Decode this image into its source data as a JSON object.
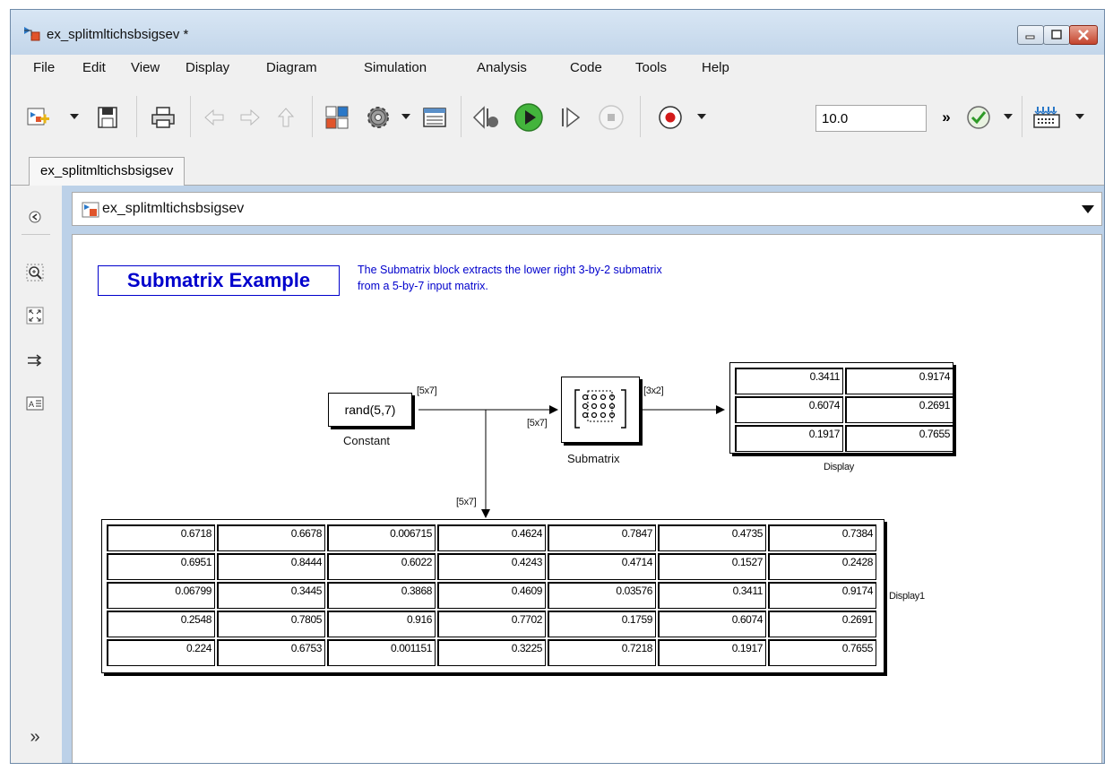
{
  "window": {
    "title": "ex_splitmltichsbsigsev *",
    "minimize_icon": "minimize-icon",
    "maximize_icon": "maximize-icon",
    "close_icon": "close-icon"
  },
  "menu": [
    "File",
    "Edit",
    "View",
    "Display",
    "Diagram",
    "Simulation",
    "Analysis",
    "Code",
    "Tools",
    "Help"
  ],
  "toolbar": {
    "stop_time": "10.0",
    "more_glyph": "»",
    "icons": [
      "new-model-icon",
      "save-icon",
      "print-icon",
      "back-icon",
      "forward-icon",
      "up-icon",
      "library-browser-icon",
      "settings-gear-icon",
      "model-explorer-icon",
      "step-back-icon",
      "run-icon",
      "step-forward-icon",
      "stop-icon",
      "record-icon",
      "more-icon",
      "check-icon",
      "build-icon"
    ]
  },
  "tab": {
    "label": "ex_splitmltichsbsigsev"
  },
  "address": {
    "path": "ex_splitmltichsbsigsev"
  },
  "leftbar": {
    "collapse_glyph": "»"
  },
  "diagram": {
    "title": "Submatrix Example",
    "description": [
      "The Submatrix block extracts the lower right 3-by-2 submatrix",
      "from a 5-by-7 input matrix."
    ],
    "constant": {
      "text": "rand(5,7)",
      "label": "Constant"
    },
    "submatrix": {
      "label": "Submatrix"
    },
    "display": {
      "label": "Display",
      "values": [
        [
          "0.3411",
          "0.9174"
        ],
        [
          "0.6074",
          "0.2691"
        ],
        [
          "0.1917",
          "0.7655"
        ]
      ]
    },
    "display1": {
      "label": "Display1",
      "values": [
        [
          "0.6718",
          "0.6678",
          "0.006715",
          "0.4624",
          "0.7847",
          "0.4735",
          "0.7384"
        ],
        [
          "0.6951",
          "0.8444",
          "0.6022",
          "0.4243",
          "0.4714",
          "0.1527",
          "0.2428"
        ],
        [
          "0.06799",
          "0.3445",
          "0.3868",
          "0.4609",
          "0.03576",
          "0.3411",
          "0.9174"
        ],
        [
          "0.2548",
          "0.7805",
          "0.916",
          "0.7702",
          "0.1759",
          "0.6074",
          "0.2691"
        ],
        [
          "0.224",
          "0.6753",
          "0.001151",
          "0.3225",
          "0.7218",
          "0.1917",
          "0.7655"
        ]
      ]
    },
    "signals": {
      "constant_out": "[5x7]",
      "submatrix_in": "[5x7]",
      "submatrix_out": "[3x2]",
      "display1_in": "[5x7]"
    }
  },
  "colors": {
    "annotation": "#0000cc",
    "titlebar": "#c3d6ea",
    "close": "#c4442d"
  }
}
